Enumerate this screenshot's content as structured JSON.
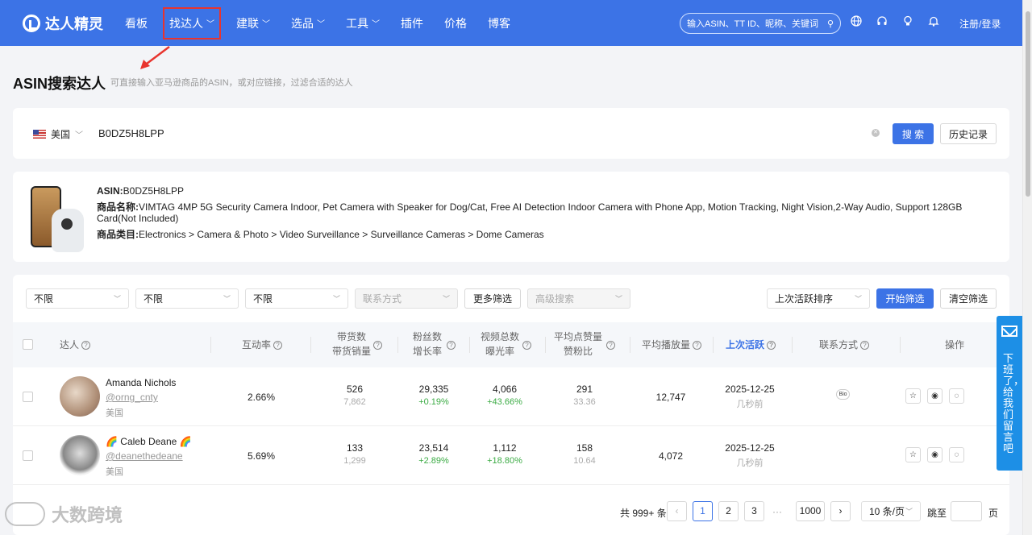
{
  "nav": {
    "brand": "达人精灵",
    "items": [
      {
        "label": "看板",
        "chevron": false
      },
      {
        "label": "找达人",
        "chevron": true
      },
      {
        "label": "建联",
        "chevron": true
      },
      {
        "label": "选品",
        "chevron": true
      },
      {
        "label": "工具",
        "chevron": true
      },
      {
        "label": "插件",
        "chevron": false
      },
      {
        "label": "价格",
        "chevron": false
      },
      {
        "label": "博客",
        "chevron": false
      }
    ],
    "search_placeholder": "输入ASIN、TT ID、昵称、关键词",
    "login": "注册/登录"
  },
  "page": {
    "title": "ASIN搜索达人",
    "subtitle": "可直接输入亚马逊商品的ASIN，或对应链接，过滤合适的达人"
  },
  "search": {
    "country": "美国",
    "value": "B0DZ5H8LPP",
    "search_button": "搜 索",
    "history_button": "历史记录"
  },
  "product": {
    "asin_label": "ASIN:",
    "asin": "B0DZ5H8LPP",
    "name_label": "商品名称:",
    "name": "VIMTAG 4MP 5G Security Camera Indoor, Pet Camera with Speaker for Dog/Cat, Free AI Detection Indoor Camera with Phone App, Motion Tracking, Night Vision,2-Way Audio, Support 128GB Card(Not Included)",
    "category_label": "商品类目:",
    "category": "Electronics > Camera & Photo > Video Surveillance > Surveillance Cameras > Dome Cameras"
  },
  "filters": {
    "f1": "不限",
    "f2": "不限",
    "f3": "不限",
    "contact": "联系方式",
    "more": "更多筛选",
    "advanced": "高级搜索",
    "sort": "上次活跃排序",
    "start": "开始筛选",
    "clear": "清空筛选"
  },
  "table": {
    "headers": {
      "creator": "达人",
      "engagement": "互动率",
      "sales1": "带货数",
      "sales2": "带货销量",
      "fans1": "粉丝数",
      "fans2": "增长率",
      "video1": "视频总数",
      "video2": "曝光率",
      "likes1": "平均点赞量",
      "likes2": "赞粉比",
      "plays": "平均播放量",
      "last_active": "上次活跃",
      "contact": "联系方式",
      "actions": "操作"
    },
    "rows": [
      {
        "name": "Amanda Nichols",
        "handle": "@orng_cnty",
        "country": "美国",
        "engagement": "2.66%",
        "items": "526",
        "sales": "7,862",
        "fans": "29,335",
        "growth": "+0.19%",
        "videos": "4,066",
        "exposure": "+43.66%",
        "avg_likes": "291",
        "like_ratio": "33.36",
        "avg_plays": "12,747",
        "last_date": "2025-12-25",
        "last_rel": "几秒前",
        "contact": "Bio"
      },
      {
        "name": "🌈 Caleb Deane 🌈",
        "handle": "@deanethedeane",
        "country": "美国",
        "engagement": "5.69%",
        "items": "133",
        "sales": "1,299",
        "fans": "23,514",
        "growth": "+2.89%",
        "videos": "1,112",
        "exposure": "+18.80%",
        "avg_likes": "158",
        "like_ratio": "10.64",
        "avg_plays": "4,072",
        "last_date": "2025-12-25",
        "last_rel": "几秒前",
        "contact": ""
      }
    ]
  },
  "pagination": {
    "total": "共 999+ 条",
    "pages": [
      "1",
      "2",
      "3"
    ],
    "ellipsis": "···",
    "last": "1000",
    "page_size": "10 条/页",
    "jump": "跳至",
    "page_unit": "页"
  },
  "feedback": {
    "text": "下班了，给我们留言吧"
  },
  "watermark": {
    "text": "大数跨境"
  },
  "colors": {
    "primary": "#3c73e6",
    "green": "#3bab44",
    "highlight": "#e8342e"
  }
}
